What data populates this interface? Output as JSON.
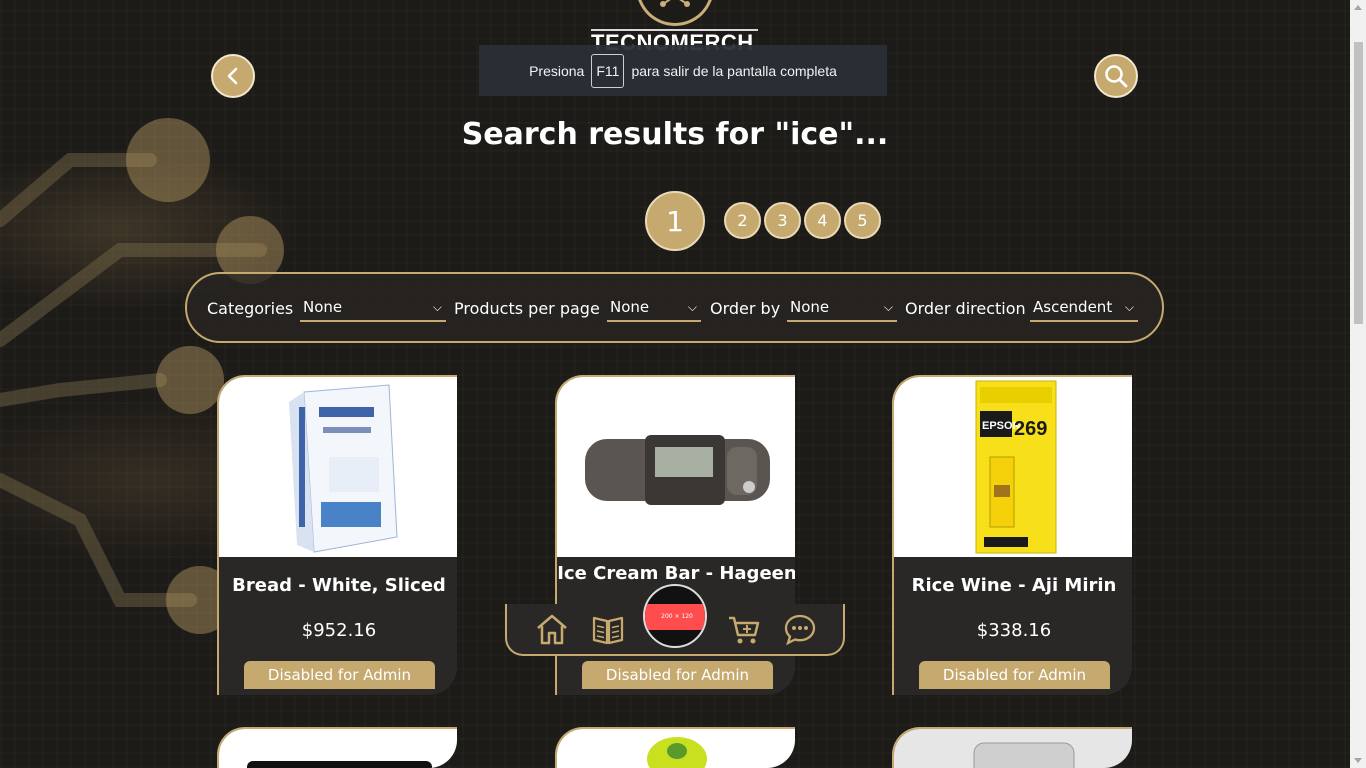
{
  "brand": {
    "name": "TECNOMERCH"
  },
  "fullscreen_notice": {
    "prefix": "Presiona",
    "key": "F11",
    "suffix": "para salir de la pantalla completa"
  },
  "search": {
    "title": "Search results for \"ice\"..."
  },
  "pagination": {
    "current": "1",
    "pages": [
      "2",
      "3",
      "4",
      "5"
    ]
  },
  "filters": {
    "categories": {
      "label": "Categories",
      "value": "None"
    },
    "per_page": {
      "label": "Products per page",
      "value": "None"
    },
    "order_by": {
      "label": "Order by",
      "value": "None"
    },
    "order_direction": {
      "label": "Order direction",
      "value": "Ascendent"
    }
  },
  "products": [
    {
      "name": "Bread - White, Sliced",
      "price": "$952.16",
      "button": "Disabled for Admin",
      "image": "usb-video-capture-box"
    },
    {
      "name": "Ice Cream Bar - Hageen",
      "price": "",
      "button": "Disabled for Admin",
      "image": "digital-music-player"
    },
    {
      "name": "Rice Wine - Aji Mirin",
      "price": "$338.16",
      "button": "Disabled for Admin",
      "image": "epson-269-ink-cartridge"
    }
  ],
  "bottom_nav": {
    "items": [
      "home-icon",
      "catalog-icon",
      "avatar",
      "cart-icon",
      "chat-icon"
    ],
    "avatar_text": "200 × 120"
  },
  "colors": {
    "accent": "#c6a96f",
    "background": "#1d1b18",
    "card": "#2a2826"
  }
}
